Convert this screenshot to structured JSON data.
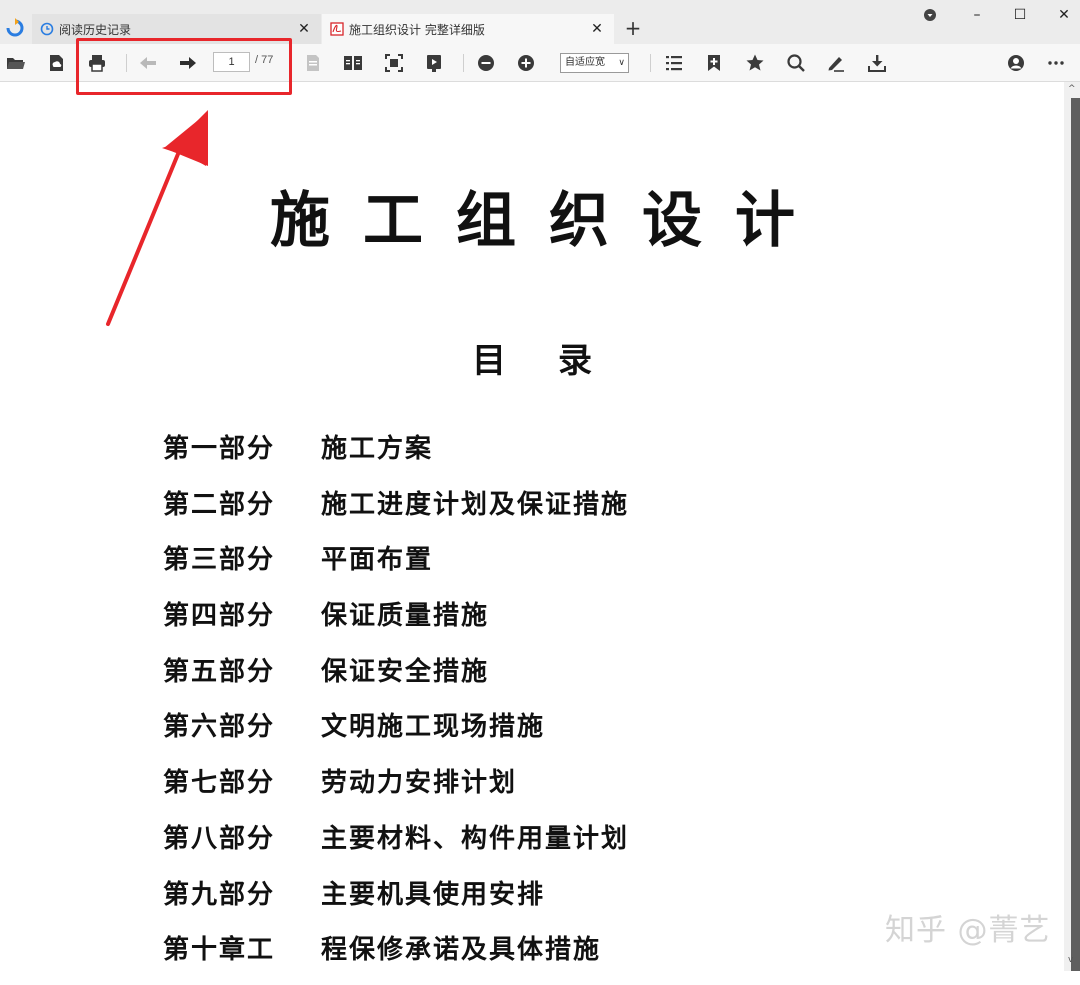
{
  "tabs": [
    {
      "label": "阅读历史记录",
      "icon": "history-icon"
    },
    {
      "label": "施工组织设计 完整详细版",
      "icon": "pdf-icon"
    }
  ],
  "toolbar": {
    "page_current": "1",
    "page_total": "/ 77",
    "zoom_label": "自适应宽"
  },
  "document": {
    "title": "施工组织设计",
    "subtitle": "目录",
    "toc": [
      {
        "part": "第一部分",
        "title": "施工方案"
      },
      {
        "part": "第二部分",
        "title": "施工进度计划及保证措施"
      },
      {
        "part": "第三部分",
        "title": "平面布置"
      },
      {
        "part": "第四部分",
        "title": "保证质量措施"
      },
      {
        "part": "第五部分",
        "title": "保证安全措施"
      },
      {
        "part": "第六部分",
        "title": "文明施工现场措施"
      },
      {
        "part": "第七部分",
        "title": "劳动力安排计划"
      },
      {
        "part": "第八部分",
        "title": "主要材料、构件用量计划"
      },
      {
        "part": "第九部分",
        "title": "主要机具使用安排"
      },
      {
        "part": "第十章工",
        "title": "程保修承诺及具体措施"
      }
    ]
  },
  "watermark": "知乎 @菁艺",
  "colors": {
    "highlight": "#e8262b",
    "arrow": "#e8262b",
    "logo": "#2a7de1"
  }
}
